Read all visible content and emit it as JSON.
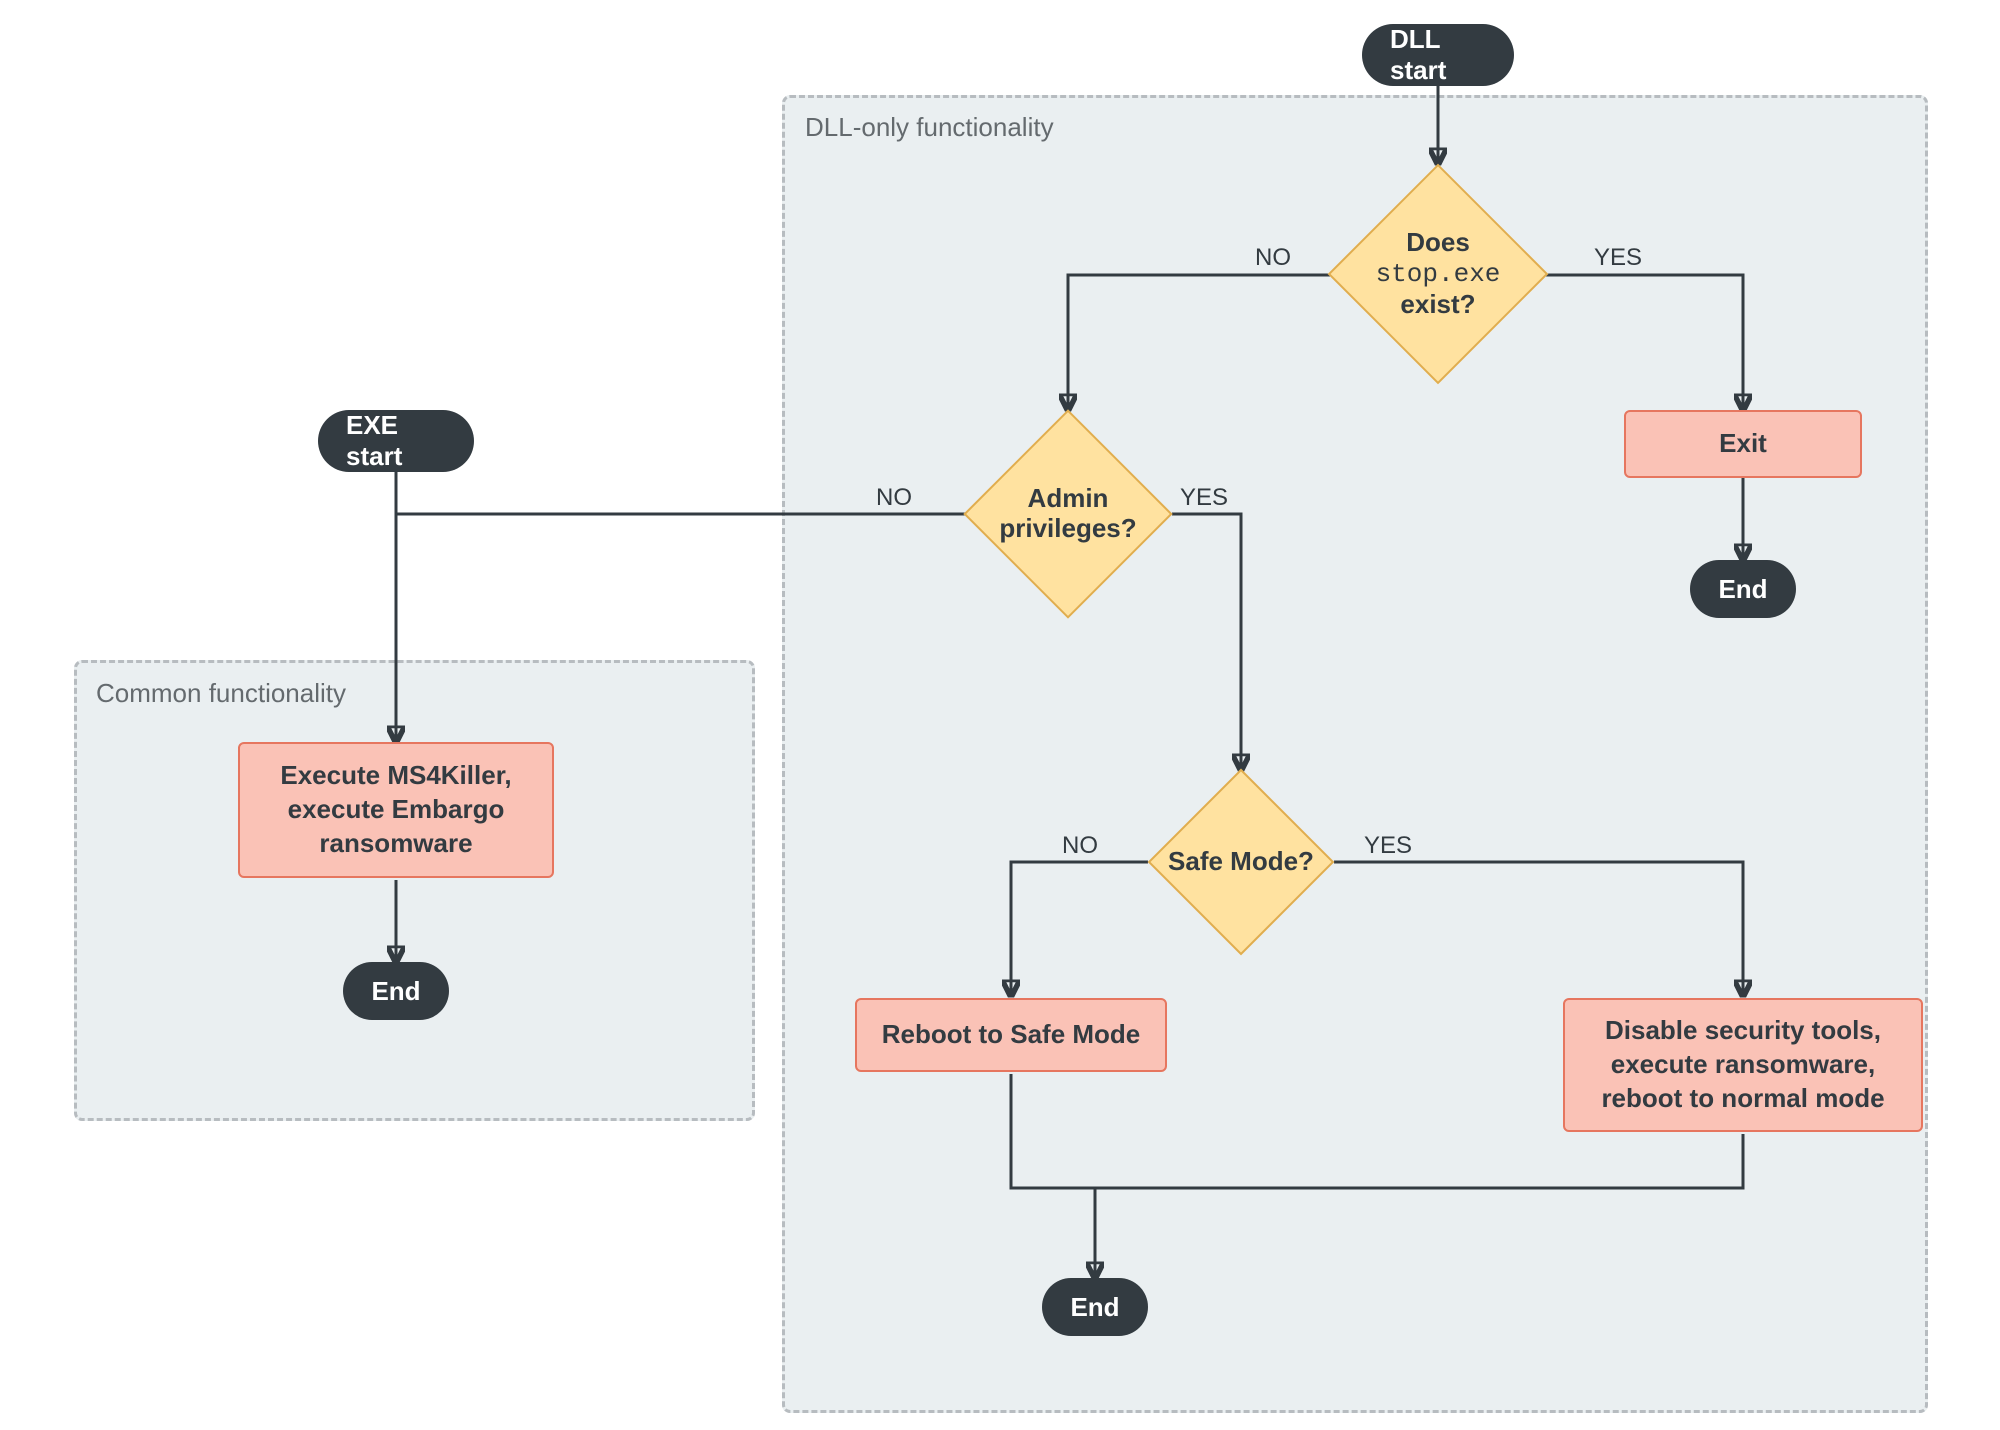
{
  "groups": {
    "dll_only": {
      "title": "DLL-only functionality"
    },
    "common": {
      "title": "Common functionality"
    }
  },
  "terminals": {
    "dll_start": "DLL start",
    "exe_start": "EXE start",
    "end_exit": "End",
    "end_common": "End",
    "end_bottom": "End"
  },
  "decisions": {
    "stop_exe_exist": {
      "line1": "Does",
      "mono": "stop.exe",
      "line3": "exist?"
    },
    "admin_priv": {
      "text": "Admin\nprivileges?"
    },
    "safe_mode": {
      "text": "Safe Mode?"
    }
  },
  "processes": {
    "exit": "Exit",
    "execute_ms4killer": "Execute MS4Killer,\nexecute Embargo\nransomware",
    "reboot_safe": "Reboot to Safe Mode",
    "disable_tools": "Disable security tools,\nexecute ransomware,\nreboot to normal mode"
  },
  "edge_labels": {
    "stop_no": "NO",
    "stop_yes": "YES",
    "admin_no": "NO",
    "admin_yes": "YES",
    "safe_no": "NO",
    "safe_yes": "YES"
  }
}
